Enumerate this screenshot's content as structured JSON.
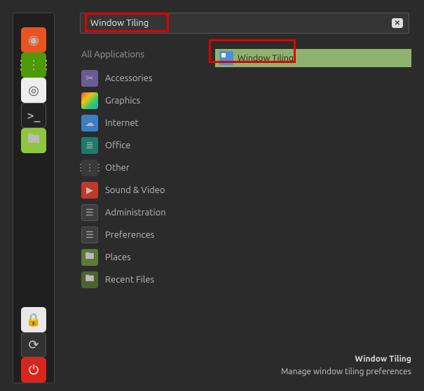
{
  "search": {
    "value": "Window Tiling",
    "clear": "✕"
  },
  "categories": {
    "header": "All Applications",
    "items": [
      {
        "label": "Accessories",
        "iconGlyph": "✂",
        "iconClass": "bg-violet"
      },
      {
        "label": "Graphics",
        "iconGlyph": "",
        "iconClass": "bg-rainbow"
      },
      {
        "label": "Internet",
        "iconGlyph": "☁",
        "iconClass": "bg-blue"
      },
      {
        "label": "Office",
        "iconGlyph": "≣",
        "iconClass": "bg-teal"
      },
      {
        "label": "Other",
        "iconGlyph": "⋮⋮⋮",
        "iconClass": "bg-grid"
      },
      {
        "label": "Sound & Video",
        "iconGlyph": "▶",
        "iconClass": "bg-red"
      },
      {
        "label": "Administration",
        "iconGlyph": "☰",
        "iconClass": "bg-admin"
      },
      {
        "label": "Preferences",
        "iconGlyph": "☰",
        "iconClass": "bg-pref"
      },
      {
        "label": "Places",
        "iconGlyph": "🖿",
        "iconClass": "bg-fold2"
      },
      {
        "label": "Recent Files",
        "iconGlyph": "🖿",
        "iconClass": "bg-fold3"
      }
    ]
  },
  "result": {
    "label": "Window Tiling"
  },
  "footer": {
    "title": "Window Tiling",
    "desc": "Manage window tiling preferences"
  },
  "panel": {
    "items": [
      {
        "glyph": "◉",
        "class": "bg-orange",
        "name": "firefox-icon"
      },
      {
        "glyph": "⋮⋮⋮",
        "class": "bg-green",
        "name": "apps-icon"
      },
      {
        "glyph": "◎",
        "class": "bg-white",
        "name": "settings-icon"
      },
      {
        "glyph": ">_",
        "class": "bg-dark",
        "name": "terminal-icon"
      },
      {
        "glyph": "🖿",
        "class": "bg-folder",
        "name": "files-icon"
      }
    ],
    "bottom": [
      {
        "glyph": "🔒",
        "class": "bg-lock",
        "name": "lock-icon"
      },
      {
        "glyph": "⟳",
        "class": "bg-ref",
        "name": "logout-icon"
      },
      {
        "glyph": "⏻",
        "class": "bg-power",
        "name": "power-icon"
      }
    ]
  }
}
